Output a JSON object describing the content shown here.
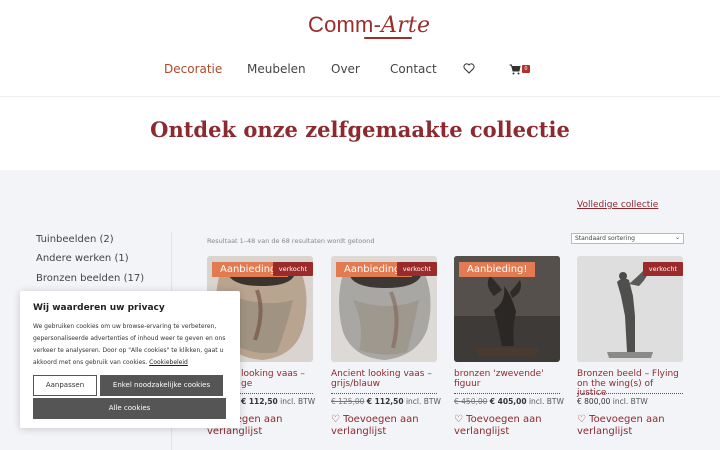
{
  "logo": {
    "text_main": "Comm-",
    "text_art": "Arte"
  },
  "nav": {
    "items": [
      {
        "label": "Decoratie",
        "active": true
      },
      {
        "label": "Meubelen",
        "active": false
      },
      {
        "label": "Over",
        "active": false
      },
      {
        "label": "Contact",
        "active": false
      }
    ],
    "wishlist_icon": "heart-icon",
    "cart_icon": "cart-icon",
    "cart_count": "0"
  },
  "hero": {
    "title": "Ontdek onze zelfgemaakte collectie"
  },
  "collection_link": "Volledige collectie",
  "sidebar": {
    "categories": [
      {
        "label": "Tuinbeelden (2)"
      },
      {
        "label": "Andere werken (1)"
      },
      {
        "label": "Bronzen beelden (17)"
      }
    ]
  },
  "results": {
    "count_text": "Resultaat 1–48 van de 68 resultaten wordt getoond",
    "sort_selected": "Standaard sortering"
  },
  "products": [
    {
      "sale_badge": "Aanbieding!",
      "sold_badge": "verkocht",
      "title": "… looking vaas – … ge",
      "title_visible": "looking vaas –",
      "title_line2": "ge",
      "price_old": "",
      "price_new": "€ 112,50",
      "price_suffix": "incl. BTW",
      "wishlist": "Toevoegen aan verlanglijst"
    },
    {
      "sale_badge": "Aanbieding!",
      "sold_badge": "verkocht",
      "title": "Ancient looking vaas – grijs/blauw",
      "price_old": "€ 125,00",
      "price_new": "€ 112,50",
      "price_suffix": "incl. BTW",
      "wishlist": "Toevoegen aan verlanglijst"
    },
    {
      "sale_badge": "Aanbieding!",
      "sold_badge": "",
      "title": "bronzen 'zwevende' figuur",
      "price_old": "€ 450,00",
      "price_new": "€ 405,00",
      "price_suffix": "incl. BTW",
      "wishlist": "Toevoegen aan verlanglijst"
    },
    {
      "sale_badge": "",
      "sold_badge": "verkocht",
      "title": "Bronzen beeld – Flying on the wing(s) of justice",
      "price_old": "",
      "price_new": "€ 800,00",
      "price_suffix": "incl. BTW",
      "wishlist": "Toevoegen aan verlanglijst"
    }
  ],
  "cookie": {
    "title": "Wij waarderen uw privacy",
    "text": "We gebruiken cookies om uw browse-ervaring te verbeteren, gepersonaliseerde advertenties of inhoud weer te geven en ons verkeer te analyseren. Door op \"Alle cookies\" te klikken, gaat u akkoord met ons gebruik van cookies.",
    "policy_link": "Cookiebeleid",
    "btn_adjust": "Aanpassen",
    "btn_necessary": "Enkel noodzakelijke cookies",
    "btn_all": "Alle cookies"
  },
  "colors": {
    "brand": "#8c2a2f",
    "sale_badge": "#e27a52",
    "sold_badge": "#9b2b2b",
    "button_dark": "#555555"
  }
}
